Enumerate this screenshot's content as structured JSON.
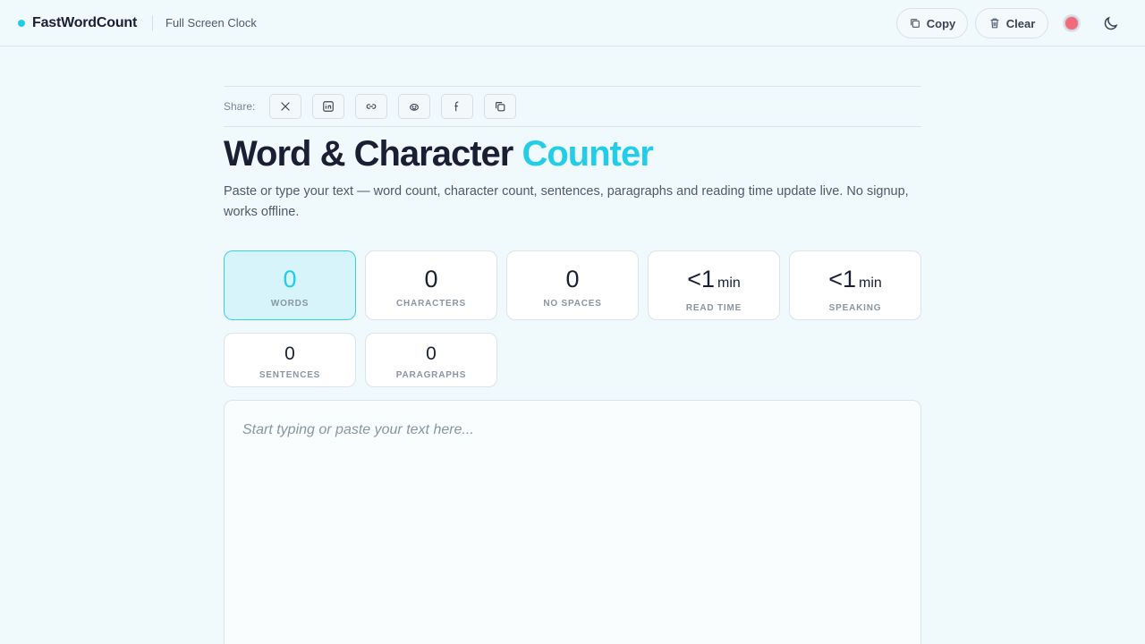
{
  "header": {
    "brand": "FastWordCount",
    "nav_link": "Full Screen Clock",
    "copy_label": "Copy",
    "clear_label": "Clear",
    "theme_color": "#f06a7c"
  },
  "share": {
    "label": "Share:",
    "buttons": [
      "x-icon",
      "linkedin-icon",
      "link-icon",
      "reddit-icon",
      "facebook-icon",
      "copy-icon"
    ]
  },
  "hero": {
    "title_main": "Word & Character",
    "title_accent": "Counter",
    "subtitle": "Paste or type your text — word count, character count, sentences, paragraphs and reading time update live. No signup, works offline."
  },
  "stats": {
    "words": {
      "value": "0",
      "label": "WORDS"
    },
    "characters": {
      "value": "0",
      "label": "CHARACTERS"
    },
    "no_spaces": {
      "value": "0",
      "label": "NO SPACES"
    },
    "read_time": {
      "value": "<1",
      "unit": "min",
      "label": "READ TIME"
    },
    "speaking": {
      "value": "<1",
      "unit": "min",
      "label": "SPEAKING"
    },
    "sentences": {
      "value": "0",
      "label": "SENTENCES"
    },
    "paragraphs": {
      "value": "0",
      "label": "PARAGRAPHS"
    }
  },
  "editor": {
    "value": "",
    "placeholder": "Start typing or paste your text here..."
  },
  "colors": {
    "accent": "#22cde8",
    "background": "#f0f9fc"
  }
}
